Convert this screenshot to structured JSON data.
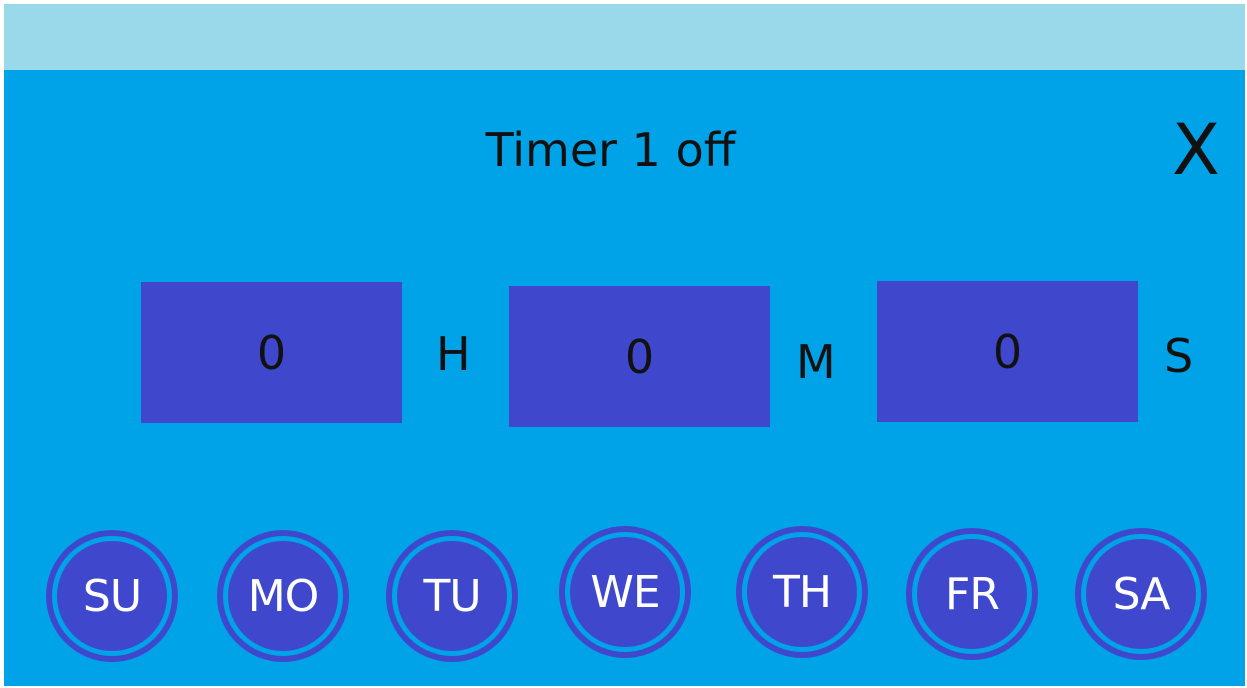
{
  "header": {
    "title": "Timer 1 off",
    "close_label": "X"
  },
  "time": {
    "hours": "0",
    "hours_unit": "H",
    "minutes": "0",
    "minutes_unit": "M",
    "seconds": "0",
    "seconds_unit": "S"
  },
  "days": [
    {
      "label": "SU"
    },
    {
      "label": "MO"
    },
    {
      "label": "TU"
    },
    {
      "label": "WE"
    },
    {
      "label": "TH"
    },
    {
      "label": "FR"
    },
    {
      "label": "SA"
    }
  ],
  "colors": {
    "background": "#00a2e8",
    "top_bar": "#99d9ea",
    "box": "#3f48cc",
    "text": "#111111",
    "day_text": "#ffffff"
  }
}
